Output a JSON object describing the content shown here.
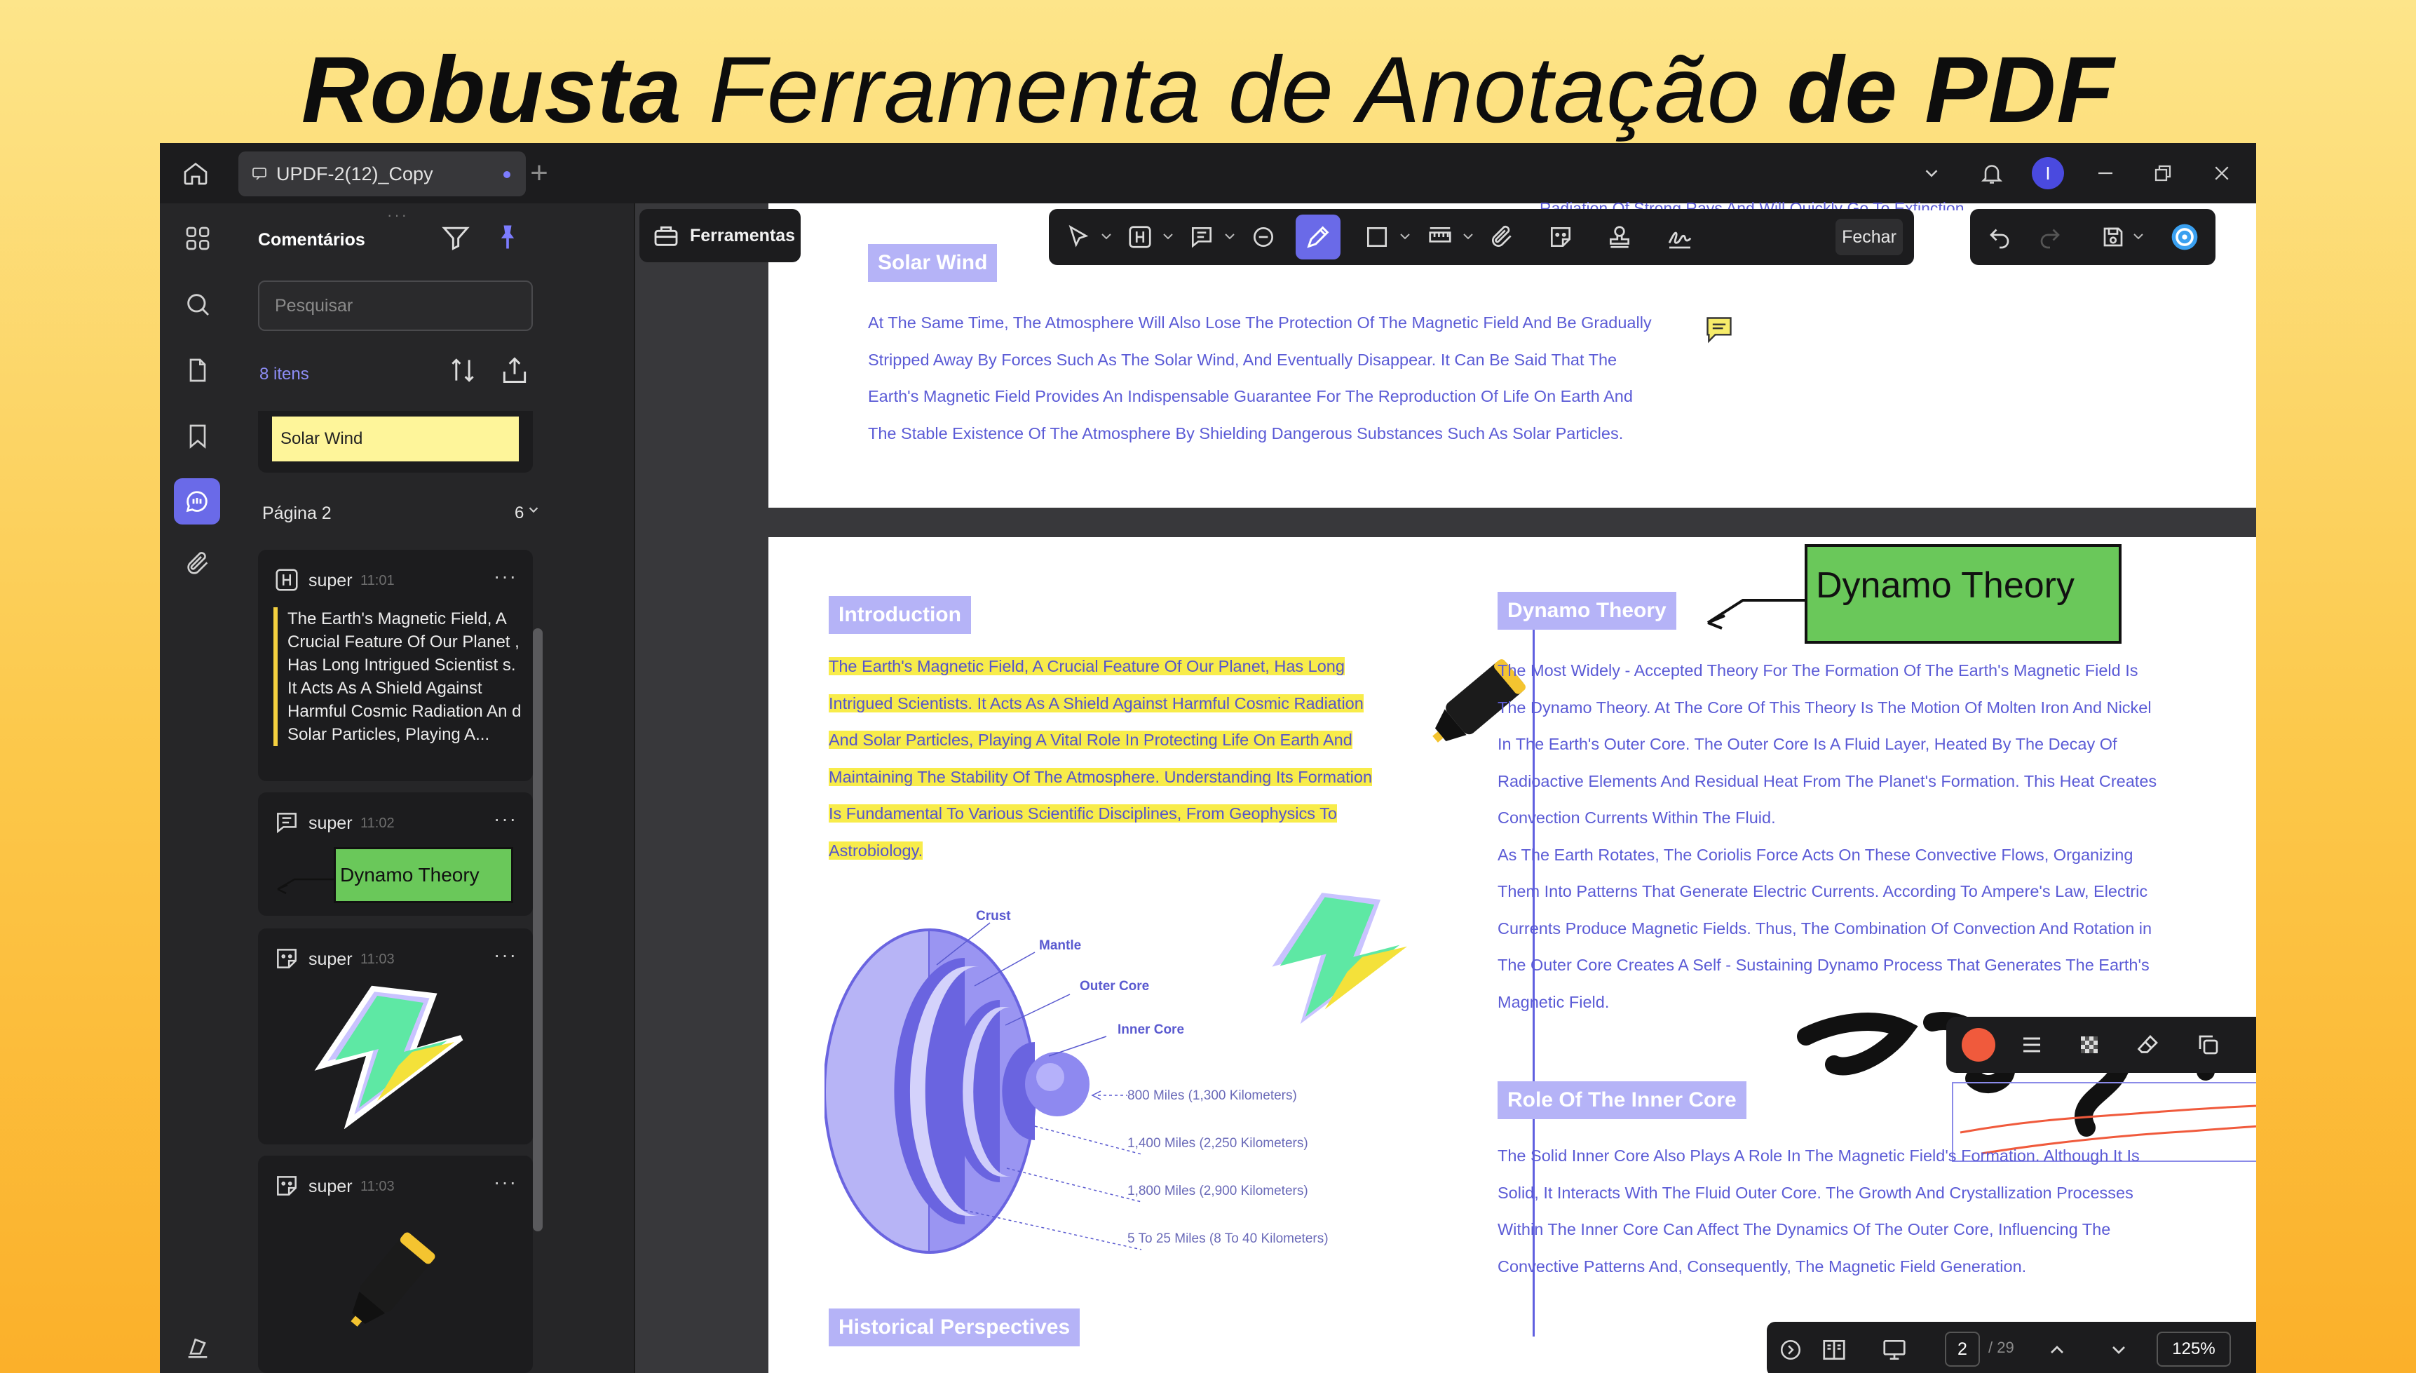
{
  "headline": {
    "part1": "Robusta",
    "part2": " Ferramenta de Anotação ",
    "part3": "de PDF"
  },
  "titlebar": {
    "home_icon": "home-icon",
    "tab_title": "UPDF-2(12)_Copy",
    "tab_add": "+",
    "avatar_letter": "I"
  },
  "rail": [
    "apps-icon",
    "search-icon",
    "page-icon",
    "bookmark-icon",
    "comment-icon",
    "attachment-icon",
    "layers-icon"
  ],
  "panel": {
    "title": "Comentários",
    "search_placeholder": "Pesquisar",
    "count": "8 itens",
    "solar_wind_item": "Solar Wind",
    "page_label": "Página 2",
    "page_count": "6",
    "cards": [
      {
        "user": "super",
        "time": "11:01",
        "icon": "highlight-icon",
        "text": "The Earth's Magnetic Field, A Crucial Feature Of Our Planet , Has Long Intrigued Scientist s. It Acts As A Shield Against Harmful Cosmic Radiation An d Solar Particles, Playing A..."
      },
      {
        "user": "super",
        "time": "11:02",
        "icon": "callout-icon",
        "callout": "Dynamo Theory"
      },
      {
        "user": "super",
        "time": "11:03",
        "icon": "sticker-icon"
      },
      {
        "user": "super",
        "time": "11:03",
        "icon": "sticker-icon"
      }
    ],
    "more": "···"
  },
  "toolbar": {
    "tools_label": "Ferramentas",
    "close_label": "Fechar"
  },
  "doc": {
    "p1_cut": "Radiation Of Strong Rays And Will Quickly Go To Extinction",
    "solar_wind_tag": "Solar Wind",
    "p1_lines": [
      "At The Same Time, The Atmosphere Will Also Lose The Protection Of The Magnetic Field And Be Gradually",
      "Stripped Away By Forces Such As The Solar Wind, And Eventually Disappear. It Can Be Said That The",
      "Earth's Magnetic Field Provides An Indispensable Guarantee For The Reproduction Of Life On Earth And",
      "The Stable Existence Of The Atmosphere By Shielding Dangerous Substances Such As Solar Particles."
    ],
    "intro_tag": "Introduction",
    "intro_lines": [
      "The Earth's Magnetic Field, A Crucial Feature Of Our Planet, Has Long",
      "Intrigued Scientists. It Acts As A Shield Against Harmful Cosmic Radiation",
      "And Solar Particles, Playing A Vital Role In Protecting Life On Earth And",
      "Maintaining The Stability Of The Atmosphere. Understanding Its Formation",
      "Is Fundamental To Various Scientific Disciplines, From Geophysics To",
      "Astrobiology."
    ],
    "diagram": {
      "crust": "Crust",
      "mantle": "Mantle",
      "outer_core": "Outer Core",
      "inner_core": "Inner Core",
      "d1": "800 Miles (1,300 Kilometers)",
      "d2": "1,400 Miles (2,250 Kilometers)",
      "d3": "1,800 Miles (2,900 Kilometers)",
      "d4": "5 To 25 Miles (8 To 40 Kilometers)"
    },
    "dynamo_tag": "Dynamo Theory",
    "dynamo_callout": "Dynamo Theory",
    "dynamo_lines": [
      "The Most Widely - Accepted Theory For The Formation Of The Earth's Magnetic Field Is",
      "The Dynamo Theory. At The Core Of This Theory Is The Motion Of Molten Iron And Nickel",
      "In The Earth's Outer Core. The Outer Core Is A Fluid Layer, Heated By The Decay Of",
      "Radioactive Elements And Residual Heat From The Planet's Formation. This Heat Creates",
      "Convection Currents Within The Fluid.",
      "As The Earth Rotates, The Coriolis Force Acts On These Convective Flows, Organizing",
      "Them Into Patterns That Generate Electric Currents. According To Ampere's Law, Electric",
      "Currents Produce Magnetic Fields. Thus, The Combination Of Convection And Rotation in",
      "The Outer Core Creates A Self - Sustaining Dynamo Process That Generates The Earth's",
      "Magnetic Field."
    ],
    "inner_tag": "Role Of The Inner Core",
    "inner_lines": [
      "The Solid Inner Core Also Plays A Role In The Magnetic Field's Formation. Although It Is",
      "Solid, It Interacts With The Fluid Outer Core. The Growth And Crystallization Processes",
      "Within The Inner Core Can Affect The Dynamics Of The Outer Core, Influencing The",
      "Convective Patterns And, Consequently, The Magnetic Field Generation."
    ],
    "historical_tag": "Historical Perspectives"
  },
  "bottom": {
    "page": "2",
    "total": "/ 29",
    "zoom": "125%"
  },
  "colors": {
    "accent": "#6a6ae8",
    "doc_text": "#5b5bd6",
    "highlight": "#f8ec4a",
    "callout_green": "#6ac85a",
    "pen_red": "#f05a3c"
  }
}
